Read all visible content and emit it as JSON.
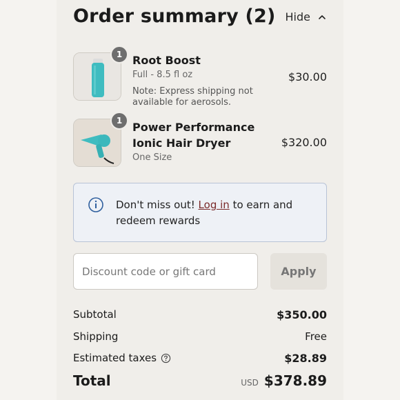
{
  "header": {
    "title": "Order summary (2)",
    "toggle_label": "Hide"
  },
  "items": [
    {
      "name": "Root Boost",
      "variant": "Full - 8.5 fl oz",
      "note": "Note: Express shipping not available for aerosols.",
      "price": "$30.00",
      "quantity": "1"
    },
    {
      "name_line1": "Power Performance",
      "name_line2": "Ionic Hair Dryer",
      "variant": "One Size",
      "price": "$320.00",
      "quantity": "1"
    }
  ],
  "rewards": {
    "prefix": "Don't miss out!",
    "link": "Log in",
    "suffix": "to earn and redeem rewards"
  },
  "discount": {
    "placeholder": "Discount code or gift card",
    "apply_label": "Apply"
  },
  "totals": {
    "subtotal_label": "Subtotal",
    "subtotal_value": "$350.00",
    "shipping_label": "Shipping",
    "shipping_value": "Free",
    "taxes_label": "Estimated taxes",
    "taxes_value": "$28.89",
    "total_label": "Total",
    "currency": "USD",
    "total_value": "$378.89"
  },
  "colors": {
    "link": "#7a2a2a",
    "info_bg": "#eef1f6",
    "info_border": "#b8c3d6",
    "info_icon": "#2f5f9e",
    "product_teal": "#3fbcc0"
  },
  "icons": {
    "hide": "chevron-up-icon",
    "info": "info-circle-icon",
    "help": "question-circle-icon"
  }
}
